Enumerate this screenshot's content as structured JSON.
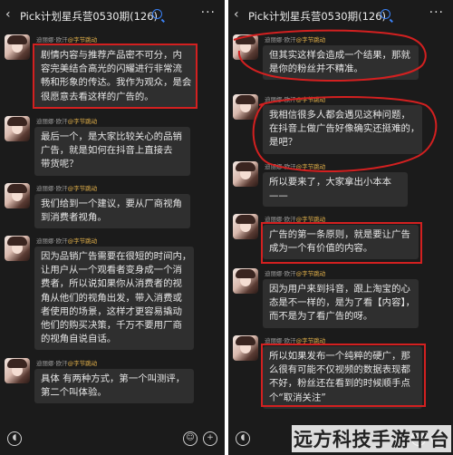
{
  "header": {
    "back_icon": "‹",
    "title": "Pick计划星兵营0530期(126)",
    "more_icon": "···"
  },
  "sender": {
    "name": "迪丽娜·欧汗",
    "tag": "@字节跳动"
  },
  "left_messages": [
    {
      "lines": [
        "剧情内容与推荐产品密不可分，内",
        "容完美结合高光的闪耀进行非常流",
        "畅和形象的传达。我作为观众，是会",
        "很愿意去看这样的广告的。"
      ]
    },
    {
      "lines": [
        "最后一个，是大家比较关心的品销",
        "广告，就是如何在抖音上直接去",
        "带货呢？"
      ]
    },
    {
      "lines": [
        "我们给到一个建议，要从厂商视角",
        "到消费者视角。"
      ]
    },
    {
      "lines": [
        "因为品销广告需要在很短的时间内，",
        "让用户从一个观看者变身成一个消",
        "费者，所以说如果你从消费者的视",
        "角从他们的视角出发，带入消费或",
        "者使用的场景，这样才更容易撬动",
        "他们的购买决策，千万不要用厂商",
        "的视角自说自话。"
      ]
    },
    {
      "lines": [
        "具体 有两种方式，第一个叫测评，",
        "第二个叫体验。"
      ]
    }
  ],
  "right_messages": [
    {
      "lines": [
        "但其实这样会造成一个结果，那就",
        "是你的粉丝并不精准。"
      ]
    },
    {
      "lines": [
        "我相信很多人都会遇见这种问题，",
        "在抖音上做广告好像确实还挺难的，",
        "是吧？"
      ]
    },
    {
      "lines": [
        "所以要来了，大家拿出小本本",
        "——"
      ]
    },
    {
      "lines": [
        "广告的第一条原则，就是要让广告",
        "成为一个有价值的内容。"
      ]
    },
    {
      "lines": [
        "因为用户来到抖音，跟上淘宝的心",
        "态是不一样的，是为了看【内容】，",
        "而不是为了看广告的呀。"
      ]
    },
    {
      "lines": [
        "所以如果发布一个纯粹的硬广，那",
        "么很有可能不仅视频的数据表现都",
        "不好，粉丝还在看到的时候顺手点",
        "个“取消关注”"
      ]
    }
  ],
  "icons": {
    "mic": "mic-icon",
    "emoji": "emoji-icon",
    "plus": "plus-icon"
  },
  "emoji_glyph": "☺",
  "plus_glyph": "+",
  "watermark": "远方科技手游平台",
  "colors": {
    "background": "#1b1b1b",
    "bubble": "#2f2f2f",
    "highlight": "#d32020",
    "tag": "#e2b04a",
    "qun_icon": "#3b82f6"
  }
}
